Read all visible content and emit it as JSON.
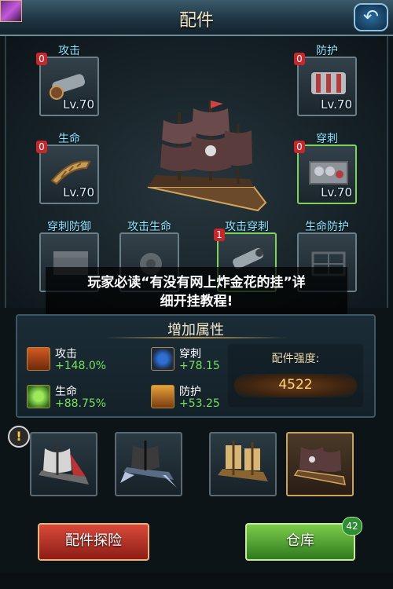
{
  "header": {
    "title": "配件"
  },
  "slots": [
    {
      "label": "攻击",
      "count": "0",
      "level": "Lv.70",
      "icon": "cannon-icon",
      "rarity": "blue"
    },
    {
      "label": "防护",
      "count": "0",
      "level": "Lv.70",
      "icon": "armor-plate-icon",
      "rarity": "blue"
    },
    {
      "label": "生命",
      "count": "0",
      "level": "Lv.70",
      "icon": "wood-hull-icon",
      "rarity": "blue"
    },
    {
      "label": "穿刺",
      "count": "0",
      "level": "Lv.70",
      "icon": "shell-crate-icon",
      "rarity": "green"
    },
    {
      "label": "穿刺防御",
      "icon": "armor-chest-icon"
    },
    {
      "label": "攻击生命",
      "icon": "gear-engine-icon"
    },
    {
      "label": "攻击穿刺",
      "count": "1",
      "icon": "barrel-icon",
      "rarity": "green"
    },
    {
      "label": "生命防护",
      "icon": "frame-icon"
    }
  ],
  "banner": {
    "line1": "玩家必读“有没有网上炸金花的挂”详",
    "line2": "细开挂教程!"
  },
  "attributes": {
    "title": "增加属性",
    "items": [
      {
        "name": "攻击",
        "value": "+148.0%",
        "icon": "attack-icon"
      },
      {
        "name": "穿刺",
        "value": "+78.15",
        "icon": "pierce-icon"
      },
      {
        "name": "生命",
        "value": "+88.75%",
        "icon": "health-icon"
      },
      {
        "name": "防护",
        "value": "+53.25",
        "icon": "defense-icon"
      }
    ],
    "strength_label": "配件强度:",
    "strength_value": "4522"
  },
  "ships": [
    {
      "icon": "ship-1-icon",
      "selected": false
    },
    {
      "icon": "ship-2-icon",
      "selected": false
    },
    {
      "icon": "ship-3-icon",
      "selected": false
    },
    {
      "icon": "ship-4-icon",
      "selected": true
    }
  ],
  "alert_icon": "!",
  "buttons": {
    "explore": "配件探险",
    "warehouse": "仓库",
    "warehouse_badge": "42"
  },
  "colors": {
    "label_cyan": "#8fe6ff",
    "value_green": "#77e05c",
    "count_red": "#c8262a",
    "explore_red": "#d84a3a",
    "warehouse_green": "#7ccc4a"
  }
}
